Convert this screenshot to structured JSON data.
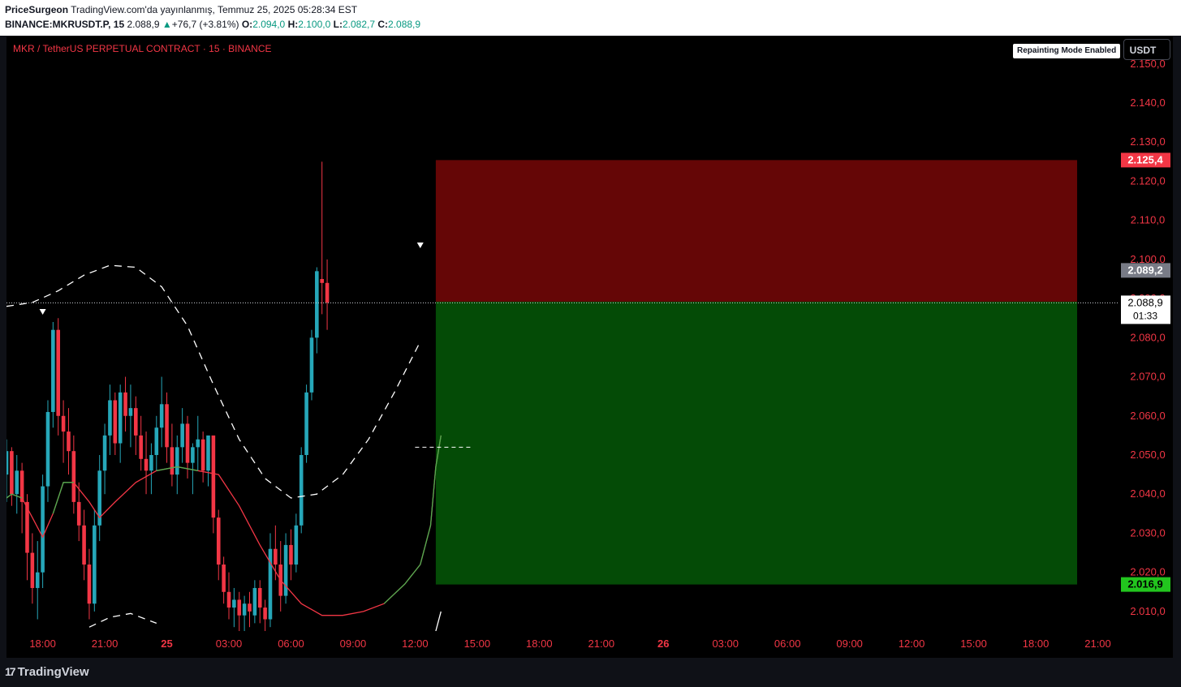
{
  "header": {
    "author": "PriceSurgeon",
    "published_text": "TradingView.com'da yayınlanmış, Temmuz 25, 2025 05:28:34 EST",
    "symbol": "BINANCE:MKRUSDT.P, 15",
    "last": "2.088,9",
    "change_arrow": "▲",
    "change": "+76,7 (+3.81%)",
    "o_label": "O:",
    "o_value": "2.094,0",
    "h_label": "H:",
    "h_value": "2.100,0",
    "l_label": "L:",
    "l_value": "2.082,7",
    "c_label": "C:",
    "c_value": "2.088,9"
  },
  "legend": {
    "title": "MKR / TetherUS PERPETUAL CONTRACT · 15 · BINANCE"
  },
  "badge": {
    "repainting": "Repainting Mode Enabled"
  },
  "currency": {
    "label": "USDT"
  },
  "footer": {
    "logo_text": "TradingView",
    "logo_mark": "17"
  },
  "colors": {
    "up": "#089981",
    "up_candle": "#26a7b9",
    "down": "#f23645",
    "stop_zone": "#650606",
    "target_zone": "#044b06",
    "red_label": "#f23645",
    "green_label": "#22c51e",
    "gray_label": "#787b86",
    "axis_text": "#f23645",
    "background": "#000000"
  },
  "chart_data": {
    "type": "candlestick",
    "timeframe": "15",
    "y_axis": {
      "range": [
        2005,
        2157
      ],
      "ticks": [
        2150,
        2140,
        2130,
        2120,
        2110,
        2100,
        2090,
        2080,
        2070,
        2060,
        2050,
        2040,
        2030,
        2020,
        2010
      ],
      "tick_labels": [
        "2.150,0",
        "2.140,0",
        "2.130,0",
        "2.120,0",
        "2.110,0",
        "2.100,0",
        "2.090,0",
        "2.080,0",
        "2.070,0",
        "2.060,0",
        "2.050,0",
        "2.040,0",
        "2.030,0",
        "2.020,0",
        "2.010,0"
      ]
    },
    "x_axis": {
      "start": "2025-07-24T16:15",
      "end": "2025-07-26T22:00",
      "ticks": [
        {
          "t": "2025-07-24T18:00",
          "label": "18:00",
          "bold": false
        },
        {
          "t": "2025-07-24T21:00",
          "label": "21:00",
          "bold": false
        },
        {
          "t": "2025-07-25T00:00",
          "label": "25",
          "bold": true
        },
        {
          "t": "2025-07-25T03:00",
          "label": "03:00",
          "bold": false
        },
        {
          "t": "2025-07-25T06:00",
          "label": "06:00",
          "bold": false
        },
        {
          "t": "2025-07-25T09:00",
          "label": "09:00",
          "bold": false
        },
        {
          "t": "2025-07-25T12:00",
          "label": "12:00",
          "bold": false
        },
        {
          "t": "2025-07-25T15:00",
          "label": "15:00",
          "bold": false
        },
        {
          "t": "2025-07-25T18:00",
          "label": "18:00",
          "bold": false
        },
        {
          "t": "2025-07-25T21:00",
          "label": "21:00",
          "bold": false
        },
        {
          "t": "2025-07-26T00:00",
          "label": "26",
          "bold": true
        },
        {
          "t": "2025-07-26T03:00",
          "label": "03:00",
          "bold": false
        },
        {
          "t": "2025-07-26T06:00",
          "label": "06:00",
          "bold": false
        },
        {
          "t": "2025-07-26T09:00",
          "label": "09:00",
          "bold": false
        },
        {
          "t": "2025-07-26T12:00",
          "label": "12:00",
          "bold": false
        },
        {
          "t": "2025-07-26T15:00",
          "label": "15:00",
          "bold": false
        },
        {
          "t": "2025-07-26T18:00",
          "label": "18:00",
          "bold": false
        },
        {
          "t": "2025-07-26T21:00",
          "label": "21:00",
          "bold": false
        }
      ]
    },
    "candles": {
      "first_time": "2025-07-24T16:15",
      "interval_minutes": 15,
      "ohlc": [
        [
          2045,
          2054,
          2038,
          2051
        ],
        [
          2051,
          2052,
          2037,
          2040
        ],
        [
          2040,
          2050,
          2035,
          2046
        ],
        [
          2046,
          2048,
          2030,
          2038
        ],
        [
          2038,
          2040,
          2018,
          2025
        ],
        [
          2025,
          2030,
          2012,
          2016
        ],
        [
          2016,
          2028,
          2008,
          2020
        ],
        [
          2020,
          2045,
          2016,
          2042
        ],
        [
          2042,
          2064,
          2038,
          2061
        ],
        [
          2061,
          2084,
          2057,
          2082
        ],
        [
          2082,
          2085,
          2055,
          2060
        ],
        [
          2060,
          2064,
          2048,
          2056
        ],
        [
          2056,
          2062,
          2045,
          2051
        ],
        [
          2051,
          2055,
          2035,
          2038
        ],
        [
          2038,
          2043,
          2028,
          2032
        ],
        [
          2032,
          2036,
          2018,
          2022
        ],
        [
          2022,
          2026,
          2008,
          2012
        ],
        [
          2012,
          2036,
          2010,
          2032
        ],
        [
          2032,
          2050,
          2028,
          2046
        ],
        [
          2046,
          2058,
          2040,
          2055
        ],
        [
          2055,
          2068,
          2050,
          2064
        ],
        [
          2064,
          2066,
          2050,
          2053
        ],
        [
          2053,
          2068,
          2048,
          2066
        ],
        [
          2066,
          2070,
          2056,
          2060
        ],
        [
          2060,
          2068,
          2052,
          2062
        ],
        [
          2062,
          2065,
          2050,
          2055
        ],
        [
          2055,
          2060,
          2046,
          2049
        ],
        [
          2049,
          2056,
          2040,
          2046
        ],
        [
          2046,
          2053,
          2040,
          2050
        ],
        [
          2050,
          2060,
          2046,
          2057
        ],
        [
          2057,
          2070,
          2052,
          2063
        ],
        [
          2063,
          2066,
          2048,
          2052
        ],
        [
          2052,
          2058,
          2042,
          2045
        ],
        [
          2045,
          2055,
          2040,
          2052
        ],
        [
          2052,
          2062,
          2048,
          2058
        ],
        [
          2058,
          2060,
          2044,
          2048
        ],
        [
          2048,
          2053,
          2040,
          2052
        ],
        [
          2052,
          2060,
          2046,
          2054
        ],
        [
          2054,
          2056,
          2043,
          2046
        ],
        [
          2046,
          2053,
          2042,
          2055
        ],
        [
          2055,
          2053,
          2030,
          2034
        ],
        [
          2034,
          2036,
          2018,
          2022
        ],
        [
          2022,
          2024,
          2012,
          2015
        ],
        [
          2015,
          2020,
          2008,
          2011
        ],
        [
          2011,
          2016,
          2006,
          2013
        ],
        [
          2013,
          2015,
          2005,
          2009
        ],
        [
          2009,
          2014,
          2004,
          2012
        ],
        [
          2012,
          2015,
          2006,
          2010
        ],
        [
          2009,
          2018,
          2007,
          2016
        ],
        [
          2016,
          2018,
          2007,
          2011
        ],
        [
          2011,
          2013,
          2005,
          2008
        ],
        [
          2008,
          2030,
          2006,
          2026
        ],
        [
          2026,
          2032,
          2018,
          2022
        ],
        [
          2022,
          2028,
          2010,
          2014
        ],
        [
          2014,
          2030,
          2012,
          2027
        ],
        [
          2027,
          2031,
          2018,
          2022
        ],
        [
          2022,
          2035,
          2020,
          2032
        ],
        [
          2032,
          2052,
          2030,
          2050
        ],
        [
          2050,
          2068,
          2048,
          2066
        ],
        [
          2066,
          2082,
          2064,
          2080
        ],
        [
          2080,
          2098,
          2076,
          2097
        ],
        [
          2095,
          2125,
          2086,
          2094
        ],
        [
          2094,
          2100,
          2082,
          2089
        ]
      ]
    },
    "current_price": 2088.9,
    "current_price_label": "2.088,9",
    "countdown": "01:33",
    "marker_price_label": "2.089,2",
    "position": {
      "side": "short",
      "entry": 2089.2,
      "stop": 2125.4,
      "stop_label": "2.125,4",
      "target": 2016.9,
      "target_label": "2.016,9",
      "start": "2025-07-25T13:00",
      "end": "2025-07-26T20:00"
    },
    "signals": [
      {
        "type": "sell",
        "time": "2025-07-24T18:00",
        "price": 2084
      },
      {
        "type": "sell",
        "time": "2025-07-25T12:15",
        "price": 2101
      }
    ],
    "dashed_level": {
      "price": 2052,
      "start": "2025-07-25T12:00",
      "end": "2025-07-25T14:45"
    },
    "envelope_upper": [
      [
        "2025-07-24T16:15",
        2088
      ],
      [
        "2025-07-24T17:30",
        2089
      ],
      [
        "2025-07-24T18:45",
        2092
      ],
      [
        "2025-07-24T20:00",
        2096
      ],
      [
        "2025-07-24T21:15",
        2098.5
      ],
      [
        "2025-07-24T22:30",
        2098
      ],
      [
        "2025-07-24T23:45",
        2093
      ],
      [
        "2025-07-25T01:00",
        2083
      ],
      [
        "2025-07-25T02:15",
        2068
      ],
      [
        "2025-07-25T03:30",
        2054
      ],
      [
        "2025-07-25T04:45",
        2044
      ],
      [
        "2025-07-25T06:00",
        2039
      ],
      [
        "2025-07-25T07:15",
        2040
      ],
      [
        "2025-07-25T08:30",
        2045
      ],
      [
        "2025-07-25T09:45",
        2054
      ],
      [
        "2025-07-25T11:00",
        2066
      ],
      [
        "2025-07-25T12:15",
        2079
      ]
    ],
    "envelope_lower": [
      [
        "2025-07-24T20:15",
        2006
      ],
      [
        "2025-07-24T21:15",
        2008.5
      ],
      [
        "2025-07-24T22:15",
        2009.5
      ],
      [
        "2025-07-24T23:30",
        2007
      ]
    ],
    "envelope_lower_tail": [
      [
        "2025-07-25T13:00",
        2005
      ],
      [
        "2025-07-25T13:15",
        2010
      ]
    ],
    "trend_line": [
      [
        "2025-07-24T16:15",
        2039
      ],
      [
        "2025-07-24T16:30",
        2040
      ],
      [
        "2025-07-24T17:00",
        2039
      ],
      [
        "2025-07-24T17:30",
        2034
      ],
      [
        "2025-07-24T18:00",
        2029
      ],
      [
        "2025-07-24T18:30",
        2035
      ],
      [
        "2025-07-24T19:00",
        2043
      ],
      [
        "2025-07-24T19:30",
        2043
      ],
      [
        "2025-07-24T20:15",
        2038
      ],
      [
        "2025-07-24T20:45",
        2034
      ],
      [
        "2025-07-24T21:30",
        2038
      ],
      [
        "2025-07-24T22:30",
        2043
      ],
      [
        "2025-07-24T23:30",
        2046
      ],
      [
        "2025-07-25T00:30",
        2047
      ],
      [
        "2025-07-25T01:30",
        2046
      ],
      [
        "2025-07-25T02:30",
        2045
      ],
      [
        "2025-07-25T03:30",
        2037
      ],
      [
        "2025-07-25T04:30",
        2027
      ],
      [
        "2025-07-25T05:30",
        2018
      ],
      [
        "2025-07-25T06:30",
        2012
      ],
      [
        "2025-07-25T07:30",
        2009
      ],
      [
        "2025-07-25T08:30",
        2009
      ],
      [
        "2025-07-25T09:30",
        2010
      ],
      [
        "2025-07-25T10:30",
        2012
      ],
      [
        "2025-07-25T11:30",
        2017
      ],
      [
        "2025-07-25T12:15",
        2022
      ],
      [
        "2025-07-25T12:45",
        2032
      ],
      [
        "2025-07-25T13:00",
        2047
      ],
      [
        "2025-07-25T13:15",
        2055
      ]
    ],
    "trend_green_segments": [
      [
        "2025-07-24T16:15",
        "2025-07-24T17:00"
      ],
      [
        "2025-07-24T18:15",
        "2025-07-24T19:45"
      ],
      [
        "2025-07-24T23:00",
        "2025-07-25T02:00"
      ],
      [
        "2025-07-25T09:45",
        "2025-07-25T13:15"
      ]
    ]
  }
}
